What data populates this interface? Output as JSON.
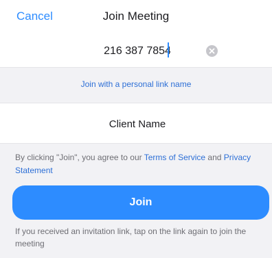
{
  "navbar": {
    "cancel_label": "Cancel",
    "title": "Join Meeting"
  },
  "meeting_id": {
    "value": "216 387 7854",
    "clear_icon": "clear-icon"
  },
  "personal_link": {
    "label": "Join with a personal link name"
  },
  "name_field": {
    "value": "Client Name"
  },
  "terms": {
    "prefix": "By clicking \"Join\", you agree to our ",
    "tos_link": "Terms of Service",
    "middle": " and ",
    "privacy_link": "Privacy Statement"
  },
  "join_button": {
    "label": "Join"
  },
  "hint": {
    "text": "If you received an invitation link, tap on the link again to join the meeting"
  },
  "colors": {
    "accent": "#2d8cff",
    "link": "#2d6fd6",
    "background": "#f2f2f5"
  }
}
